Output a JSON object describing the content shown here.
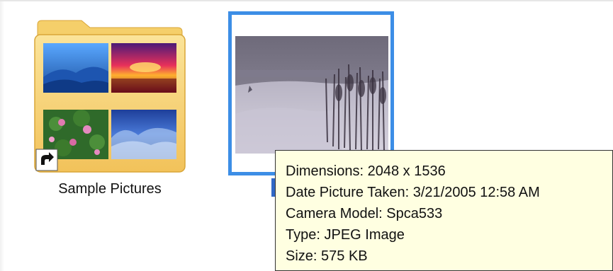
{
  "items": [
    {
      "label": "Sample Pictures",
      "kind": "folder-shortcut",
      "icon": "folder-shortcut-icon"
    },
    {
      "label": "",
      "kind": "image",
      "icon": "photo-thumbnail",
      "selected": true
    }
  ],
  "tooltip": {
    "dimensions": "Dimensions: 2048 x 1536",
    "date_taken": "Date Picture Taken: 3/21/2005 12:58 AM",
    "camera_model": "Camera Model: Spca533",
    "type": "Type: JPEG Image",
    "size": "Size: 575 KB"
  },
  "colors": {
    "selection_border": "#3c8ee6",
    "label_selection": "#3168c6",
    "tooltip_bg": "#ffffe1",
    "folder_yellow": "#f7d67a"
  }
}
